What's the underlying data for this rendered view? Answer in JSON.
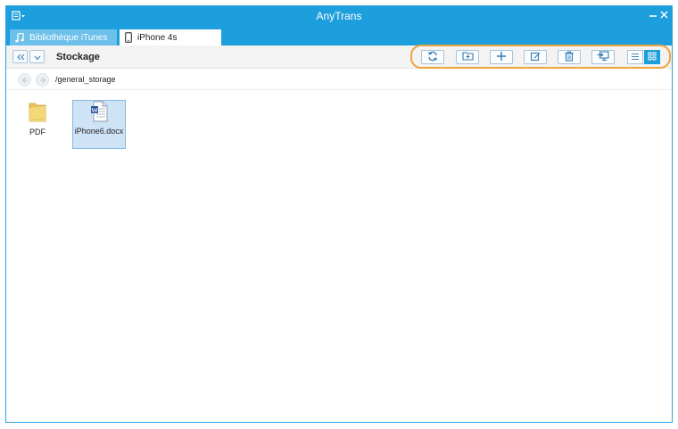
{
  "window": {
    "title": "AnyTrans"
  },
  "tabs": [
    {
      "label": "Bibliothèque iTunes",
      "icon": "music-note-icon",
      "active": false
    },
    {
      "label": "iPhone 4s",
      "icon": "phone-icon",
      "active": true
    }
  ],
  "toolbar": {
    "section_title": "Stockage",
    "tools": [
      {
        "name": "refresh",
        "icon": "refresh-icon"
      },
      {
        "name": "new-folder",
        "icon": "new-folder-icon"
      },
      {
        "name": "add",
        "icon": "plus-icon"
      },
      {
        "name": "edit",
        "icon": "edit-icon"
      },
      {
        "name": "delete",
        "icon": "trash-icon"
      },
      {
        "name": "export-to-computer",
        "icon": "export-to-pc-icon"
      }
    ],
    "views": [
      {
        "name": "list-view",
        "icon": "list-view-icon",
        "active": false
      },
      {
        "name": "grid-view",
        "icon": "grid-view-icon",
        "active": true
      }
    ]
  },
  "path": {
    "current": "/general_storage"
  },
  "files": [
    {
      "name": "PDF",
      "type": "folder",
      "icon": "folder-icon",
      "selected": false
    },
    {
      "name": "iPhone6.docx",
      "type": "document",
      "icon": "word-document-icon",
      "selected": true
    }
  ],
  "colors": {
    "accent": "#1e9fdd",
    "highlight": "#f0a33a",
    "selection": "#cfe3f7"
  }
}
